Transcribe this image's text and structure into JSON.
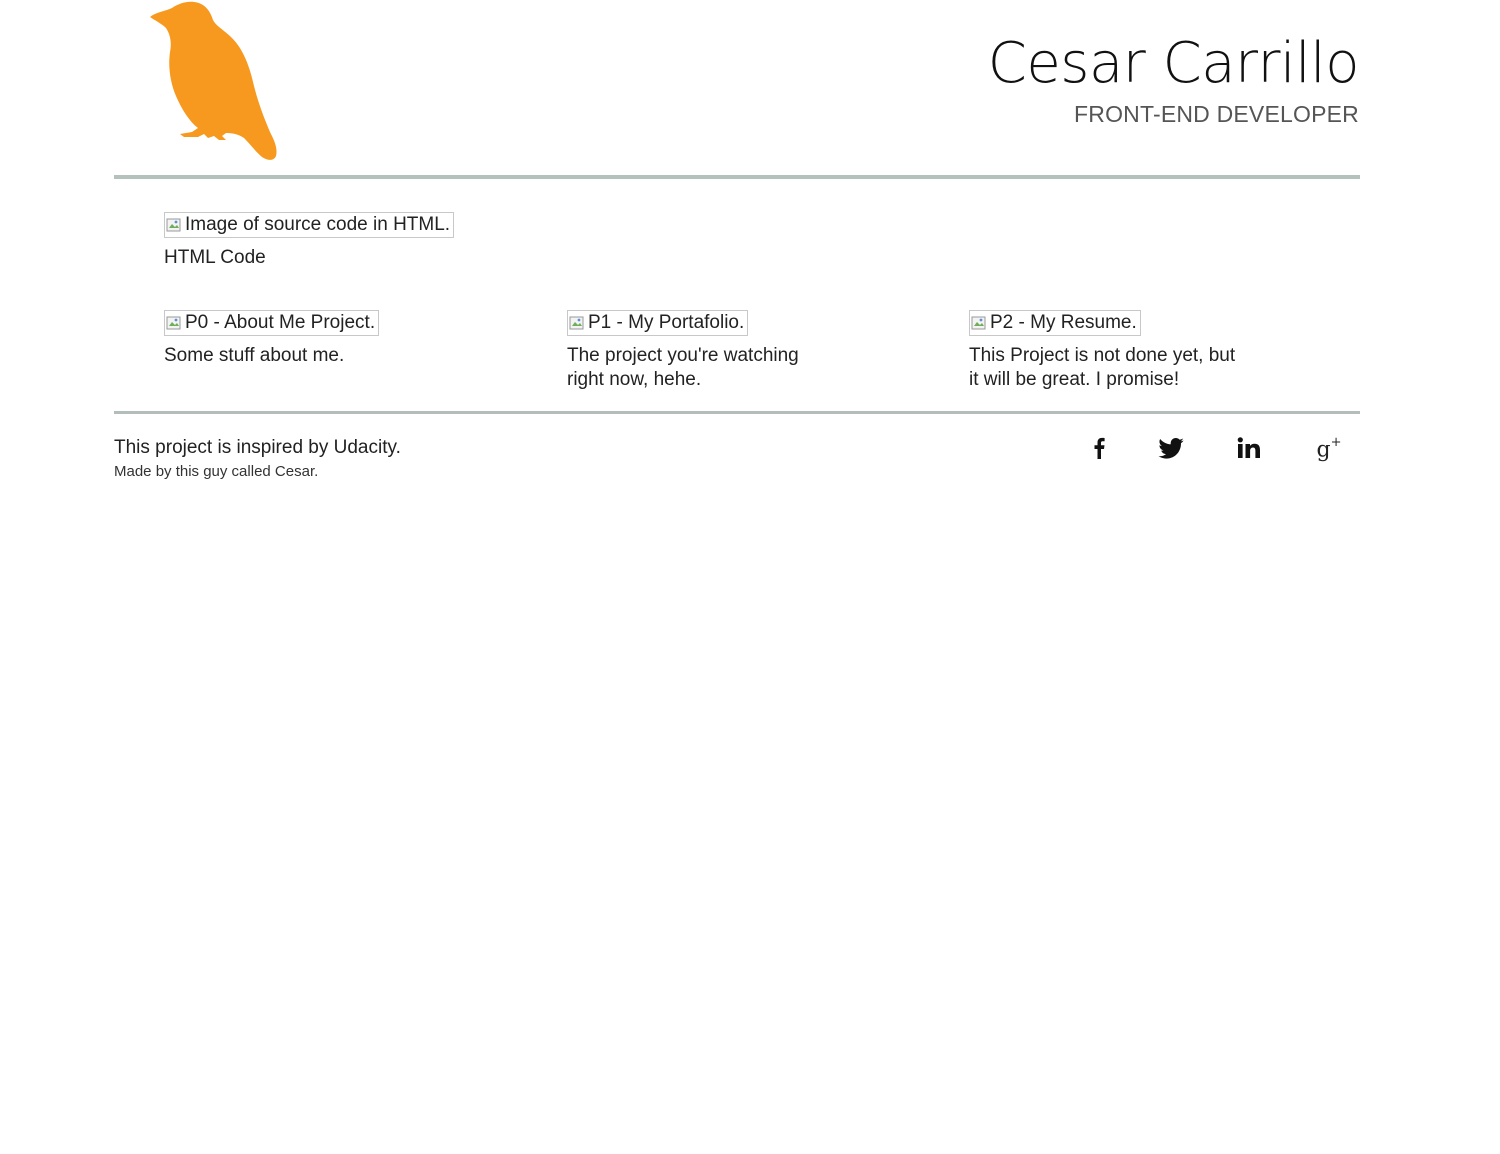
{
  "header": {
    "name": "Cesar Carrillo",
    "role": "FRONT-END DEVELOPER",
    "logo_icon": "bird-logo-icon",
    "logo_color": "#F7991F"
  },
  "featured": {
    "image_alt": "Image of source code in HTML.",
    "caption": "HTML Code"
  },
  "projects": [
    {
      "image_alt": "P0 - About Me Project.",
      "caption_line1": "Some stuff about me.",
      "caption_line2": ""
    },
    {
      "image_alt": "P1 - My Portafolio.",
      "caption_line1": "The project you're watching",
      "caption_line2": "right now, hehe."
    },
    {
      "image_alt": "P2 - My Resume.",
      "caption_line1": "This Project is not done yet, but",
      "caption_line2": "it will be great. I promise!"
    }
  ],
  "footer": {
    "inspired": "This project is inspired by Udacity.",
    "made_by": "Made by this guy called Cesar.",
    "social": [
      {
        "icon": "facebook-icon"
      },
      {
        "icon": "twitter-icon"
      },
      {
        "icon": "linkedin-icon",
        "label": "in"
      },
      {
        "icon": "google-plus-icon",
        "label": "g",
        "sup": "+"
      }
    ]
  },
  "colors": {
    "accent": "#F7991F",
    "rule": "#B5C1BD"
  }
}
